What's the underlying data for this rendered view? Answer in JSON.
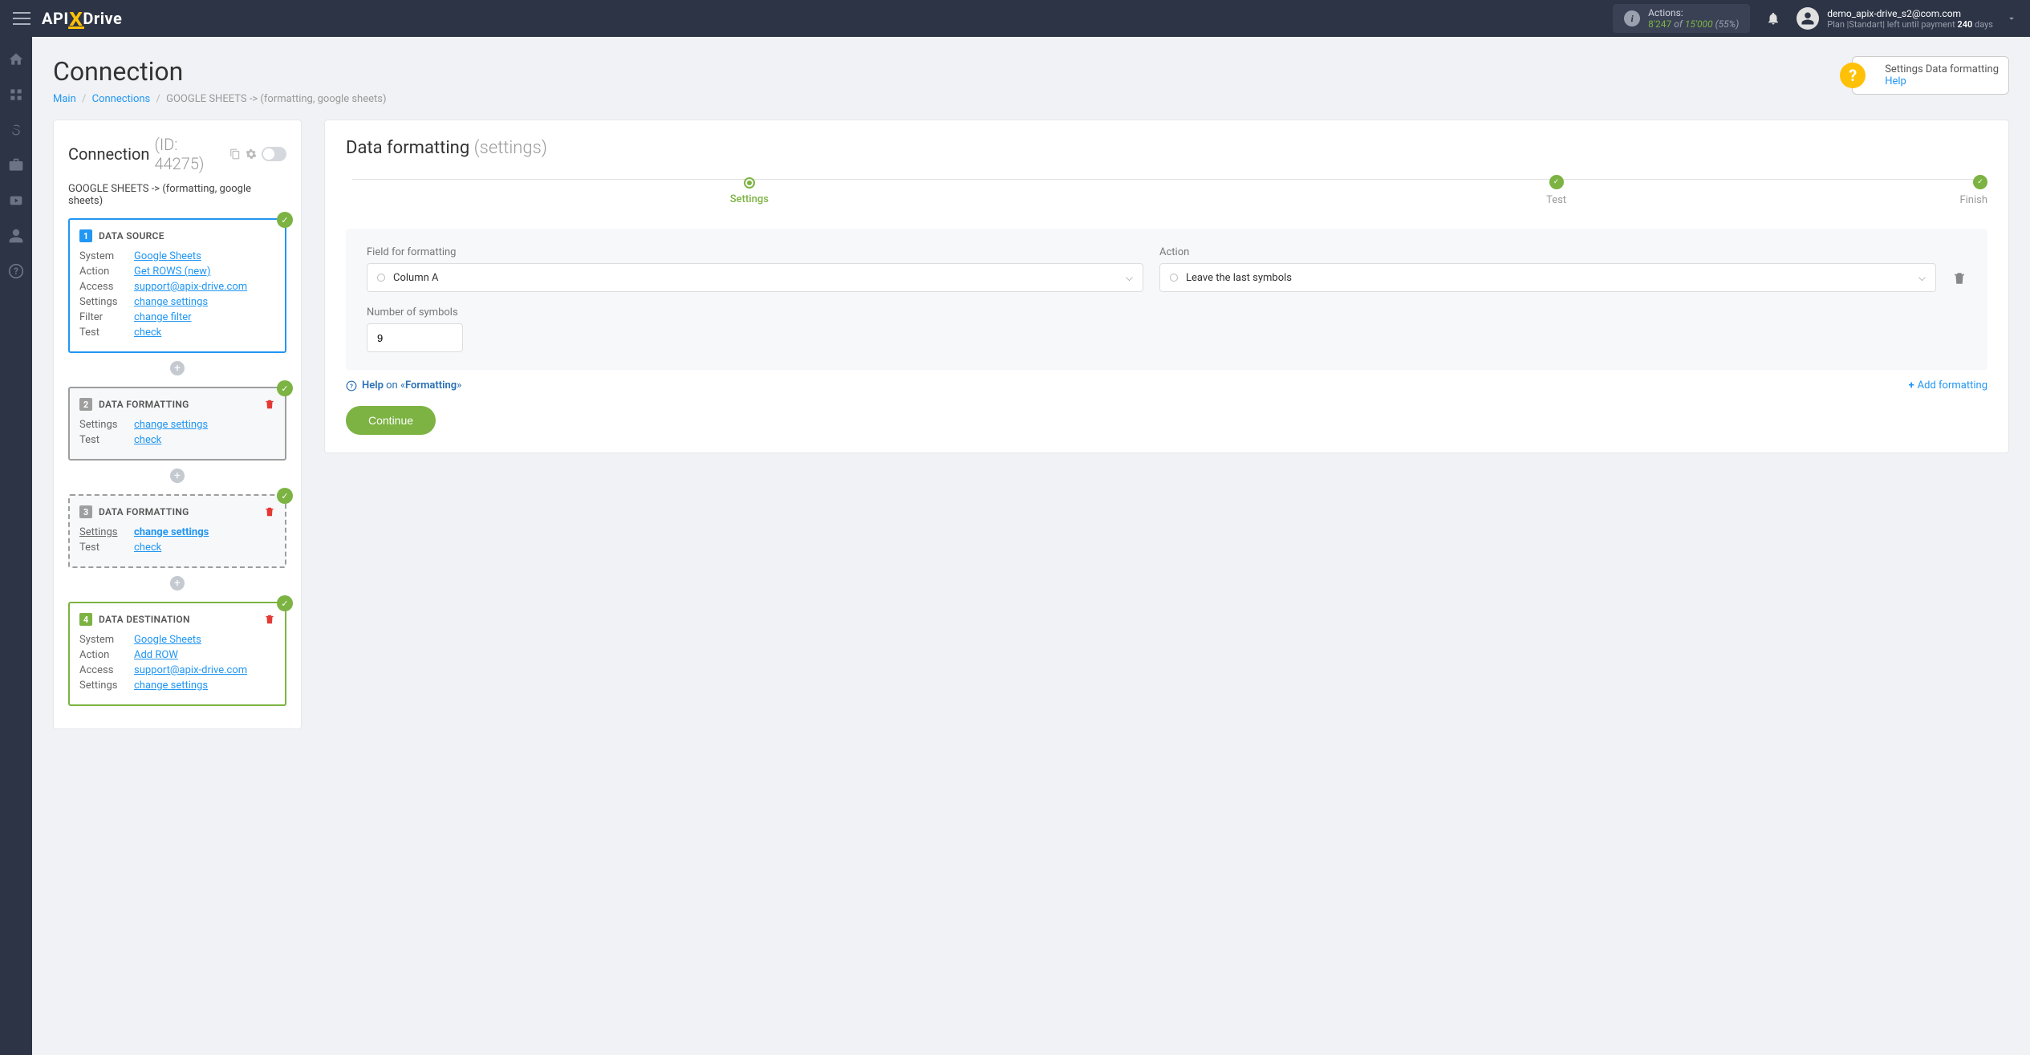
{
  "header": {
    "logo": {
      "part1": "API",
      "part2": "X",
      "part3": "Drive"
    },
    "actions": {
      "label": "Actions:",
      "used": "8'247",
      "of": "of",
      "total": "15'000",
      "pct": "(55%)"
    },
    "user": {
      "email": "demo_apix-drive_s2@com.com",
      "plan_prefix": "Plan |",
      "plan_name": "Standart",
      "plan_mid": "| left until payment",
      "days": "240",
      "days_suffix": "days"
    }
  },
  "page": {
    "title": "Connection",
    "breadcrumb": {
      "main": "Main",
      "connections": "Connections",
      "current": "GOOGLE SHEETS -> (formatting, google sheets)"
    },
    "help_widget": {
      "title": "Settings Data formatting",
      "link": "Help"
    }
  },
  "sidebar": {
    "title": "Connection",
    "id_label": "(ID: 44275)",
    "conn_name": "GOOGLE SHEETS -> (formatting, google sheets)",
    "blocks": [
      {
        "num": "1",
        "title": "DATA SOURCE",
        "rows": [
          {
            "k": "System",
            "v": "Google Sheets"
          },
          {
            "k": "Action",
            "v": "Get ROWS (new)"
          },
          {
            "k": "Access",
            "v": "support@apix-drive.com"
          },
          {
            "k": "Settings",
            "v": "change settings"
          },
          {
            "k": "Filter",
            "v": "change filter"
          },
          {
            "k": "Test",
            "v": "check"
          }
        ]
      },
      {
        "num": "2",
        "title": "DATA FORMATTING",
        "rows": [
          {
            "k": "Settings",
            "v": "change settings"
          },
          {
            "k": "Test",
            "v": "check"
          }
        ]
      },
      {
        "num": "3",
        "title": "DATA FORMATTING",
        "rows": [
          {
            "k": "Settings",
            "v": "change settings"
          },
          {
            "k": "Test",
            "v": "check"
          }
        ]
      },
      {
        "num": "4",
        "title": "DATA DESTINATION",
        "rows": [
          {
            "k": "System",
            "v": "Google Sheets"
          },
          {
            "k": "Action",
            "v": "Add ROW"
          },
          {
            "k": "Access",
            "v": "support@apix-drive.com"
          },
          {
            "k": "Settings",
            "v": "change settings"
          }
        ]
      }
    ]
  },
  "content": {
    "title": "Data formatting",
    "subtitle": "(settings)",
    "steps": [
      "Settings",
      "Test",
      "Finish"
    ],
    "form": {
      "field_label": "Field for formatting",
      "field_value": "Column A",
      "action_label": "Action",
      "action_value": "Leave the last symbols",
      "number_label": "Number of symbols",
      "number_value": "9"
    },
    "help_line": {
      "help": "Help",
      "on": "on «",
      "topic": "Formatting",
      "close": "»",
      "add": "Add formatting"
    },
    "continue": "Continue"
  }
}
